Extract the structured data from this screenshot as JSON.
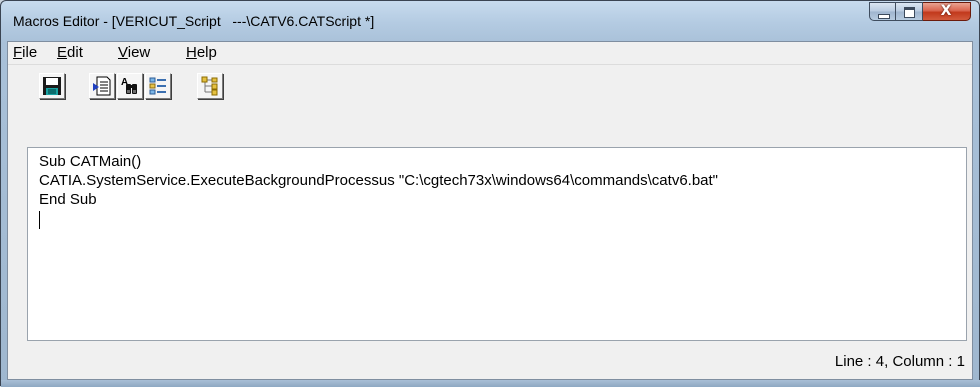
{
  "window": {
    "title": "Macros Editor - [VERICUT_Script   ---\\CATV6.CATScript *]"
  },
  "caption_buttons": {
    "minimize_icon": "minimize-icon",
    "maximize_icon": "maximize-icon",
    "close_glyph": "X"
  },
  "menu": {
    "items": [
      {
        "hotkey": "F",
        "rest": "ile"
      },
      {
        "hotkey": "E",
        "rest": "dit"
      },
      {
        "hotkey": "V",
        "rest": "iew"
      },
      {
        "hotkey": "H",
        "rest": "elp"
      }
    ]
  },
  "toolbar": {
    "buttons": [
      {
        "icon": "save-icon"
      },
      {
        "icon": "insert-file-icon"
      },
      {
        "icon": "find-replace-icon"
      },
      {
        "icon": "object-browser-icon"
      },
      {
        "icon": "tree-structure-icon"
      }
    ]
  },
  "editor": {
    "lines": [
      "Sub CATMain()",
      "CATIA.SystemService.ExecuteBackgroundProcessus \"C:\\cgtech73x\\windows64\\commands\\catv6.bat\"",
      "End Sub",
      ""
    ]
  },
  "status": {
    "line_label": "Line : 4,",
    "column_label": "Column : 1"
  },
  "colors": {
    "titlebar": "#b4cbe2",
    "close_button": "#c2391c",
    "client_bg": "#f0f0f0",
    "editor_bg": "#ffffff"
  }
}
